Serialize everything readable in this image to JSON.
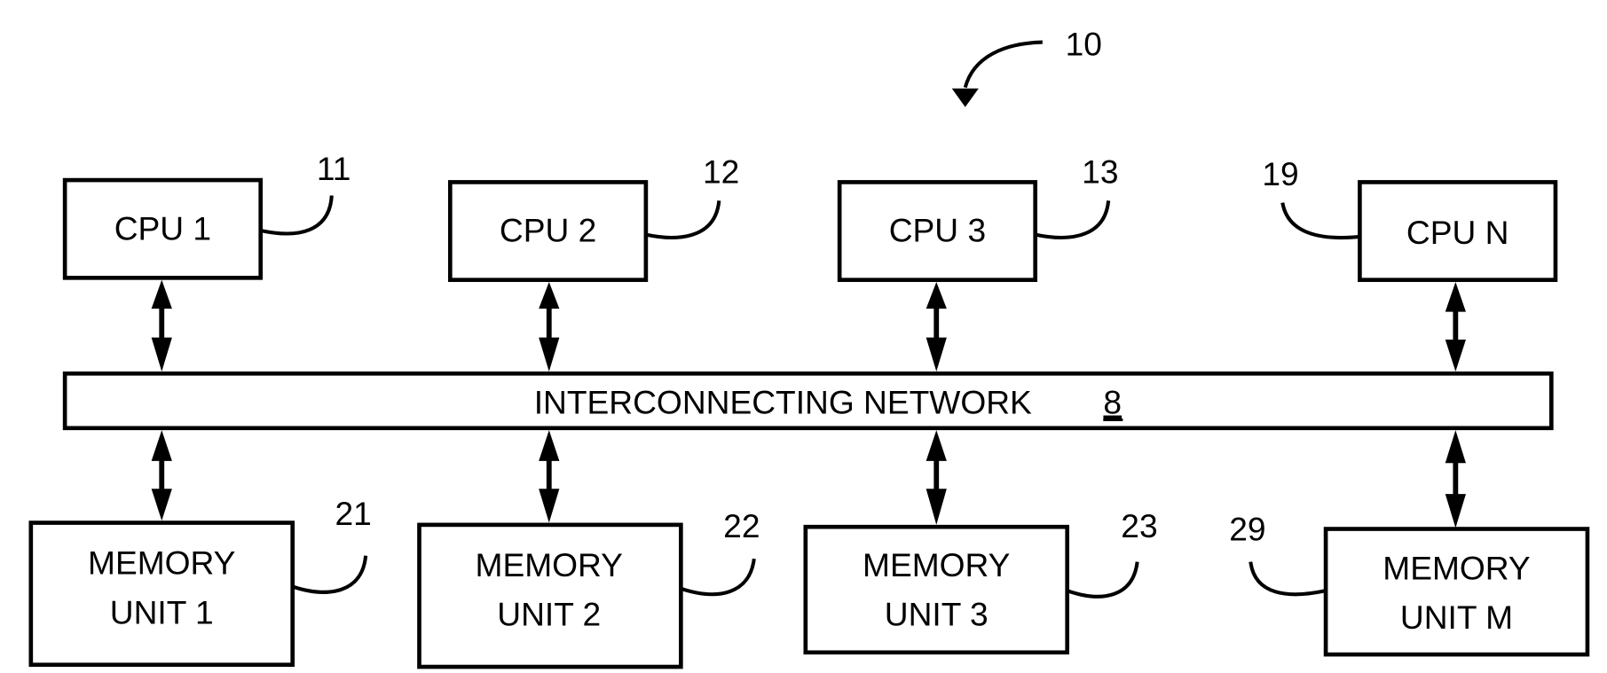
{
  "figure_ref": "10",
  "network": {
    "label": "INTERCONNECTING NETWORK",
    "ref": "8"
  },
  "cpus": [
    {
      "label": "CPU 1",
      "ref": "11"
    },
    {
      "label": "CPU 2",
      "ref": "12"
    },
    {
      "label": "CPU 3",
      "ref": "13"
    },
    {
      "label": "CPU N",
      "ref": "19"
    }
  ],
  "memories": [
    {
      "line1": "MEMORY",
      "line2": "UNIT 1",
      "ref": "21"
    },
    {
      "line1": "MEMORY",
      "line2": "UNIT 2",
      "ref": "22"
    },
    {
      "line1": "MEMORY",
      "line2": "UNIT 3",
      "ref": "23"
    },
    {
      "line1": "MEMORY",
      "line2": "UNIT M",
      "ref": "29"
    }
  ],
  "colors": {
    "stroke": "#000000",
    "background": "#ffffff"
  }
}
